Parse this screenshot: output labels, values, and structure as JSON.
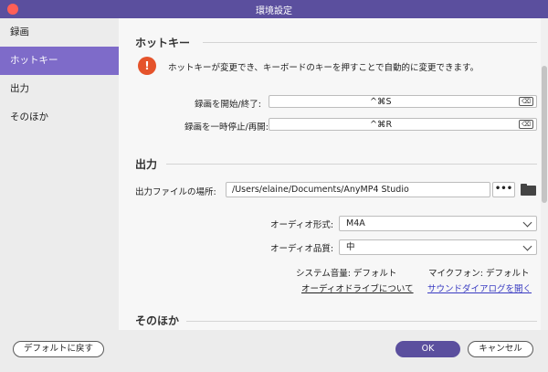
{
  "window": {
    "title": "環境設定"
  },
  "sidebar": {
    "items": [
      {
        "label": "録画"
      },
      {
        "label": "ホットキー"
      },
      {
        "label": "出力"
      },
      {
        "label": "そのほか"
      }
    ]
  },
  "hotkey": {
    "section_title": "ホットキー",
    "warning": "ホットキーが変更でき、キーボードのキーを押すことで自動的に変更できます。",
    "rows": [
      {
        "label": "録画を開始/終了:",
        "value": "^⌘S"
      },
      {
        "label": "録画を一時停止/再開:",
        "value": "^⌘R"
      }
    ]
  },
  "output": {
    "section_title": "出力",
    "location_label": "出力ファイルの場所:",
    "location_value": "/Users/elaine/Documents/AnyMP4 Studio",
    "browse_label": "•••",
    "audio_format_label": "オーディオ形式:",
    "audio_format_value": "M4A",
    "audio_quality_label": "オーディオ品質:",
    "audio_quality_value": "中",
    "system_volume": "システム音量: デフォルト",
    "mic": "マイクフォン: デフォルト",
    "driver_link": "オーディオドライブについて",
    "sound_dialog_link": "サウンドダイアログを開く"
  },
  "other": {
    "section_title": "そのほか"
  },
  "footer": {
    "reset_label": "デフォルトに戻す",
    "ok_label": "OK",
    "cancel_label": "キャンセル"
  },
  "colors": {
    "accent": "#5b4f9e",
    "sidebar_active": "#7e6bc9",
    "warning": "#e5532b",
    "link": "#3a3cc2"
  }
}
